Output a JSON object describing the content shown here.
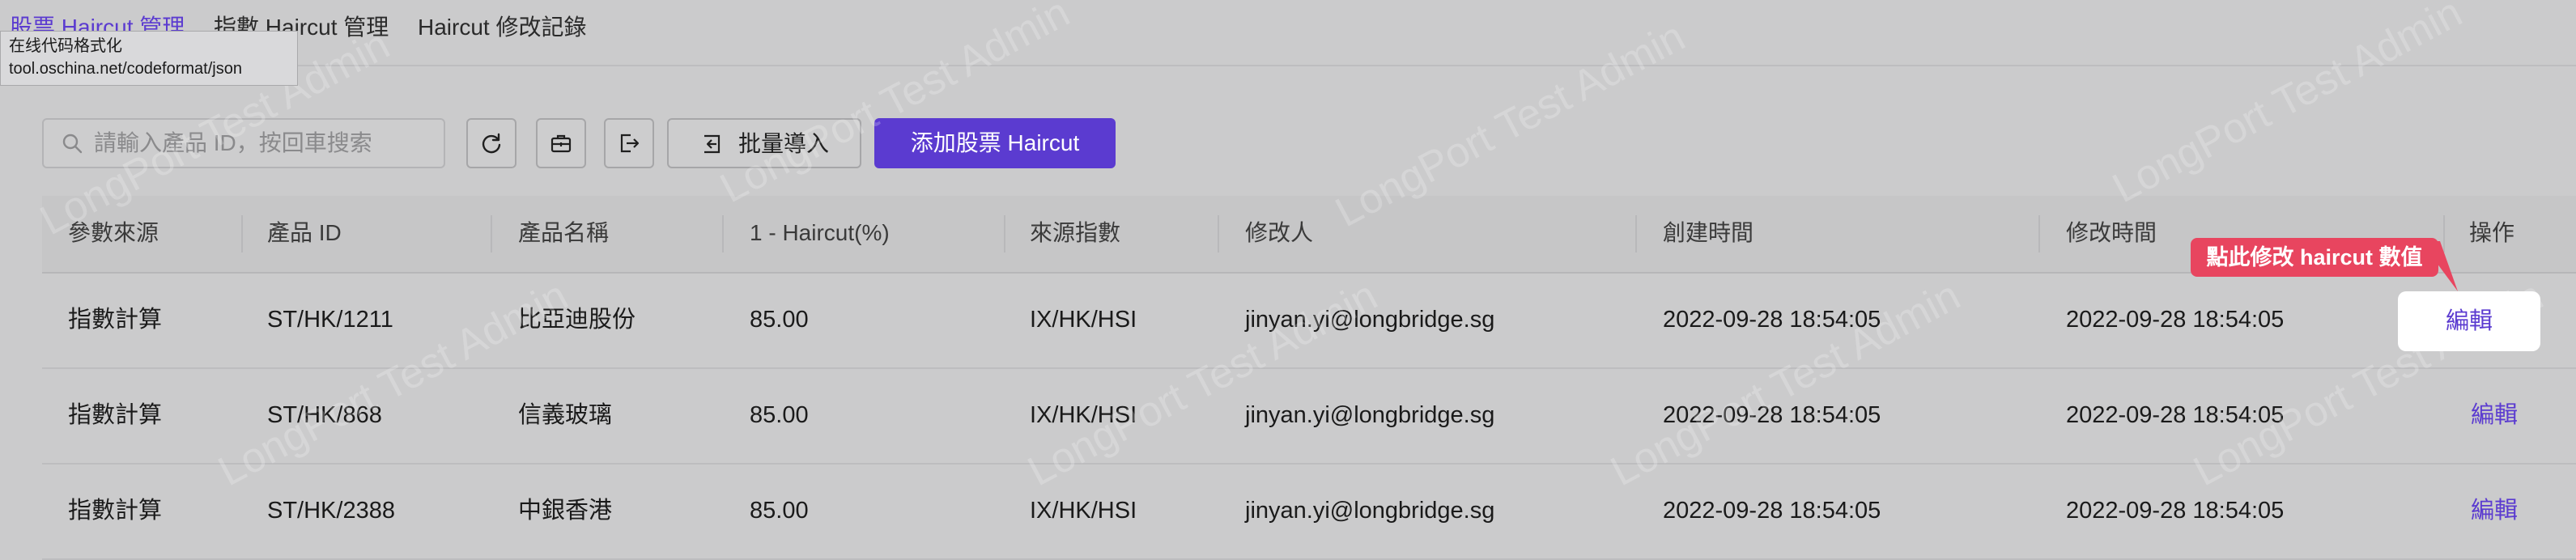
{
  "tabs": [
    {
      "label": "股票 Haircut 管理",
      "active": true
    },
    {
      "label": "指數 Haircut 管理",
      "active": false
    },
    {
      "label": "Haircut 修改記錄",
      "active": false
    }
  ],
  "url_tooltip": {
    "line1": "在线代码格式化",
    "line2": "tool.oschina.net/codeformat/json"
  },
  "toolbar": {
    "search_placeholder": "請輸入產品 ID，按回車搜索",
    "refresh_icon": "refresh-icon",
    "bag_icon": "briefcase-icon",
    "export_icon": "export-icon",
    "import_label": "批量導入",
    "add_label": "添加股票 Haircut"
  },
  "watermark": "LongPort Test Admin",
  "table": {
    "headers": [
      "參數來源",
      "產品 ID",
      "產品名稱",
      "1 - Haircut(%)",
      "來源指數",
      "修改人",
      "創建時間",
      "修改時間",
      "操作"
    ],
    "rows": [
      [
        "指數計算",
        "ST/HK/1211",
        "比亞迪股份",
        "85.00",
        "IX/HK/HSI",
        "jinyan.yi@longbridge.sg",
        "2022-09-28 18:54:05",
        "2022-09-28 18:54:05",
        "編輯"
      ],
      [
        "指數計算",
        "ST/HK/868",
        "信義玻璃",
        "85.00",
        "IX/HK/HSI",
        "jinyan.yi@longbridge.sg",
        "2022-09-28 18:54:05",
        "2022-09-28 18:54:05",
        "編輯"
      ],
      [
        "指數計算",
        "ST/HK/2388",
        "中銀香港",
        "85.00",
        "IX/HK/HSI",
        "jinyan.yi@longbridge.sg",
        "2022-09-28 18:54:05",
        "2022-09-28 18:54:05",
        "編輯"
      ]
    ]
  },
  "callout": {
    "text": "點此修改 haircut 數值"
  },
  "colors": {
    "accent": "#5b3bd0",
    "callout": "#e8455f",
    "background": "#cbcbcc"
  }
}
